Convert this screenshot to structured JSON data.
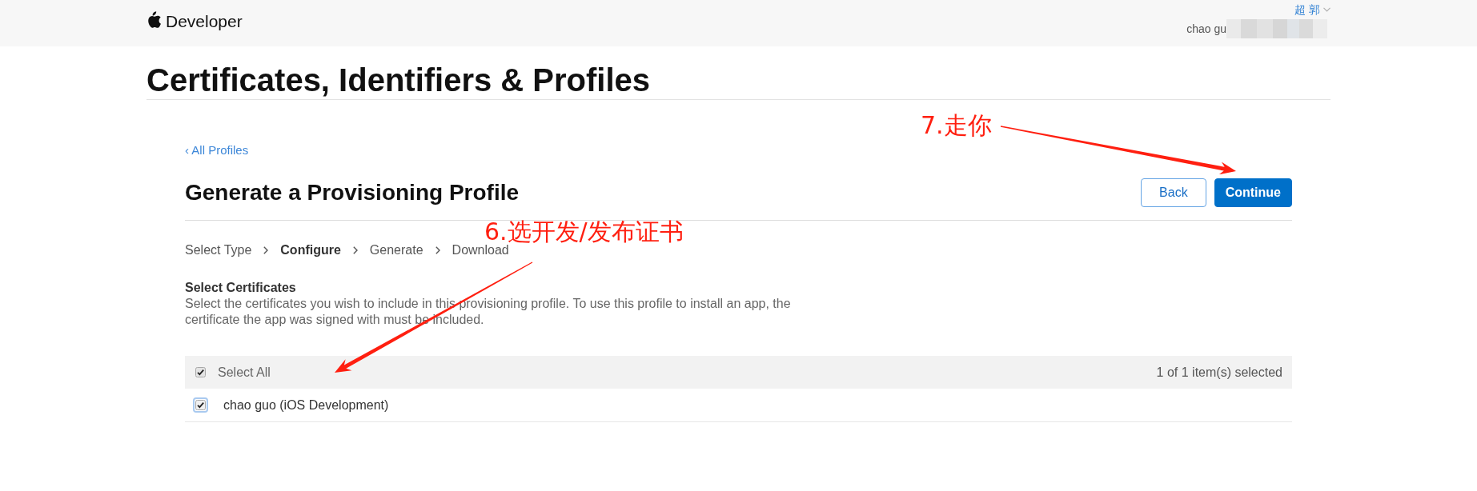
{
  "header": {
    "brand": "Developer",
    "user_menu": "超 郭",
    "account_name": "chao gu"
  },
  "page_title": "Certificates, Identifiers & Profiles",
  "back_link": "‹ All Profiles",
  "heading": "Generate a Provisioning Profile",
  "buttons": [
    {
      "label": "Back",
      "kind": "secondary"
    },
    {
      "label": "Continue",
      "kind": "primary"
    }
  ],
  "steps": [
    {
      "label": "Select Type",
      "selected": false
    },
    {
      "label": "Configure",
      "selected": true
    },
    {
      "label": "Generate",
      "selected": false
    },
    {
      "label": "Download",
      "selected": false
    }
  ],
  "section": {
    "title": "Select Certificates",
    "description": "Select the certificates you wish to include in this provisioning profile. To use this profile to install an app, the certificate the app was signed with must be included."
  },
  "table": {
    "select_all": {
      "label": "Select All",
      "checked": true
    },
    "selection_count": "1 of 1 item(s) selected",
    "rows": [
      {
        "name": "chao guo (iOS Development)",
        "checked": true,
        "focused": true
      }
    ]
  },
  "annotations": [
    {
      "text": "7.走你"
    },
    {
      "text": "6.选开发/发布证书"
    }
  ]
}
